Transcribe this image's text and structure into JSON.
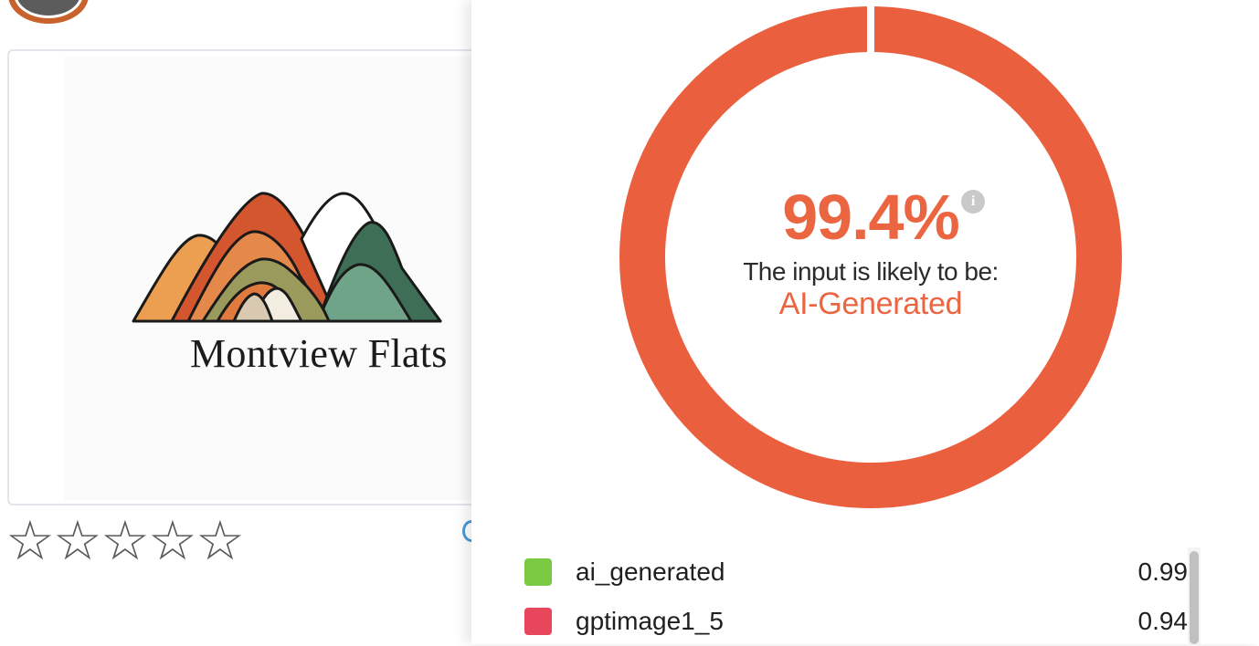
{
  "image_card": {
    "logo_text": "Montview Flats"
  },
  "rating": {
    "stars": [
      "☆",
      "☆",
      "☆",
      "☆",
      "☆"
    ],
    "value": 0,
    "max": 5
  },
  "result": {
    "percent": "99.4%",
    "likely_label": "The input is likely to be:",
    "verdict": "AI-Generated",
    "info_icon": "i",
    "score_fraction": 0.994
  },
  "scores": [
    {
      "label": "ai_generated",
      "value": "0.99",
      "color": "#7ac943"
    },
    {
      "label": "gptimage1_5",
      "value": "0.94",
      "color": "#e8465a"
    }
  ],
  "colors": {
    "accent": "#ec6541",
    "donut_ring": "#ea5f3d"
  }
}
